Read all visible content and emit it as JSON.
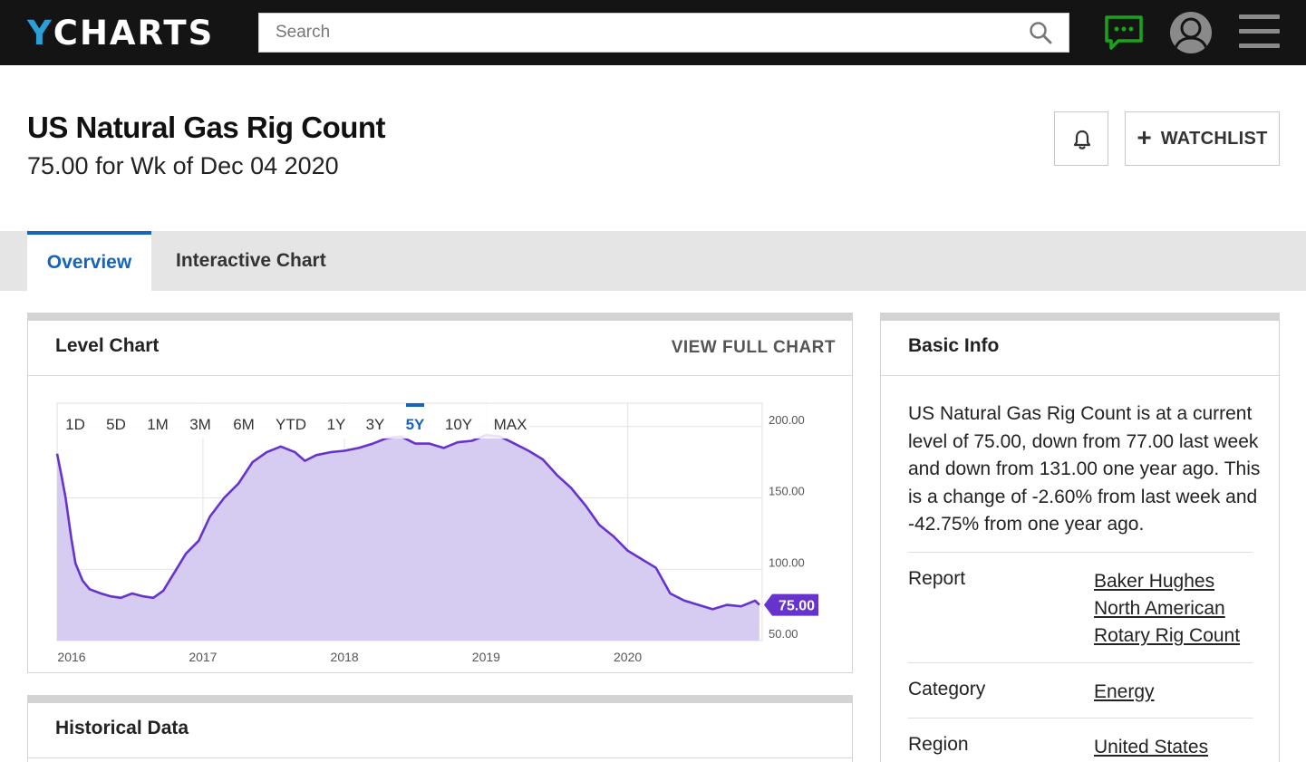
{
  "header": {
    "logo_y": "Y",
    "logo_rest": "CHARTS",
    "search_placeholder": "Search",
    "icons": [
      "search-icon",
      "chat-icon",
      "user-avatar-icon",
      "menu-icon"
    ],
    "chat_color": "#1ca31c"
  },
  "page": {
    "title": "US Natural Gas Rig Count",
    "subtitle": "75.00 for Wk of Dec 04 2020",
    "watchlist_label": "WATCHLIST"
  },
  "tabs": [
    {
      "label": "Overview",
      "active": true
    },
    {
      "label": "Interactive Chart",
      "active": false
    }
  ],
  "level_chart": {
    "title": "Level Chart",
    "view_full_label": "VIEW FULL CHART"
  },
  "historical": {
    "title": "Historical Data"
  },
  "basic_info": {
    "title": "Basic Info",
    "description": "US Natural Gas Rig Count is at a current level of 75.00, down from 77.00 last week and down from 131.00 one year ago. This is a change of -2.60% from last week and -42.75% from one year ago.",
    "rows": [
      {
        "key": "Report",
        "value": "Baker Hughes North American Rotary Rig Count"
      },
      {
        "key": "Category",
        "value": "Energy"
      },
      {
        "key": "Region",
        "value": "United States"
      }
    ]
  },
  "chart_data": {
    "type": "area",
    "ranges": [
      "1D",
      "5D",
      "1M",
      "3M",
      "6M",
      "YTD",
      "1Y",
      "3Y",
      "5Y",
      "10Y",
      "MAX"
    ],
    "active_range": "5Y",
    "x_ticks": [
      "2016",
      "2017",
      "2018",
      "2019",
      "2020"
    ],
    "y_ticks": [
      "200.00",
      "150.00",
      "100.00",
      "50.00"
    ],
    "ylim": [
      50,
      210
    ],
    "xlim": [
      2015.97,
      2020.95
    ],
    "current_value_label": "75.00",
    "grid": true,
    "color_line": "#6633cc",
    "color_fill": "#d6cbf1",
    "series": [
      {
        "values": [
          [
            2015.97,
            181
          ],
          [
            2016.0,
            166
          ],
          [
            2016.03,
            150
          ],
          [
            2016.07,
            122
          ],
          [
            2016.1,
            104
          ],
          [
            2016.15,
            92
          ],
          [
            2016.2,
            86
          ],
          [
            2016.28,
            83
          ],
          [
            2016.35,
            81
          ],
          [
            2016.42,
            80
          ],
          [
            2016.5,
            83
          ],
          [
            2016.58,
            81
          ],
          [
            2016.65,
            80
          ],
          [
            2016.72,
            85
          ],
          [
            2016.8,
            98
          ],
          [
            2016.88,
            111
          ],
          [
            2016.97,
            120
          ],
          [
            2017.05,
            137
          ],
          [
            2017.15,
            150
          ],
          [
            2017.25,
            160
          ],
          [
            2017.35,
            175
          ],
          [
            2017.45,
            182
          ],
          [
            2017.55,
            186
          ],
          [
            2017.65,
            182
          ],
          [
            2017.72,
            176
          ],
          [
            2017.8,
            180
          ],
          [
            2017.9,
            182
          ],
          [
            2018.0,
            183
          ],
          [
            2018.1,
            185
          ],
          [
            2018.2,
            188
          ],
          [
            2018.3,
            192
          ],
          [
            2018.4,
            193
          ],
          [
            2018.5,
            188
          ],
          [
            2018.6,
            188
          ],
          [
            2018.7,
            185
          ],
          [
            2018.8,
            189
          ],
          [
            2018.9,
            190
          ],
          [
            2019.0,
            194
          ],
          [
            2019.1,
            193
          ],
          [
            2019.2,
            188
          ],
          [
            2019.3,
            183
          ],
          [
            2019.4,
            177
          ],
          [
            2019.5,
            166
          ],
          [
            2019.6,
            157
          ],
          [
            2019.7,
            145
          ],
          [
            2019.8,
            131
          ],
          [
            2019.9,
            123
          ],
          [
            2020.0,
            113
          ],
          [
            2020.1,
            107
          ],
          [
            2020.2,
            101
          ],
          [
            2020.3,
            83
          ],
          [
            2020.4,
            78
          ],
          [
            2020.5,
            75
          ],
          [
            2020.6,
            72
          ],
          [
            2020.7,
            75
          ],
          [
            2020.8,
            74
          ],
          [
            2020.9,
            78
          ],
          [
            2020.93,
            75
          ]
        ]
      }
    ]
  }
}
